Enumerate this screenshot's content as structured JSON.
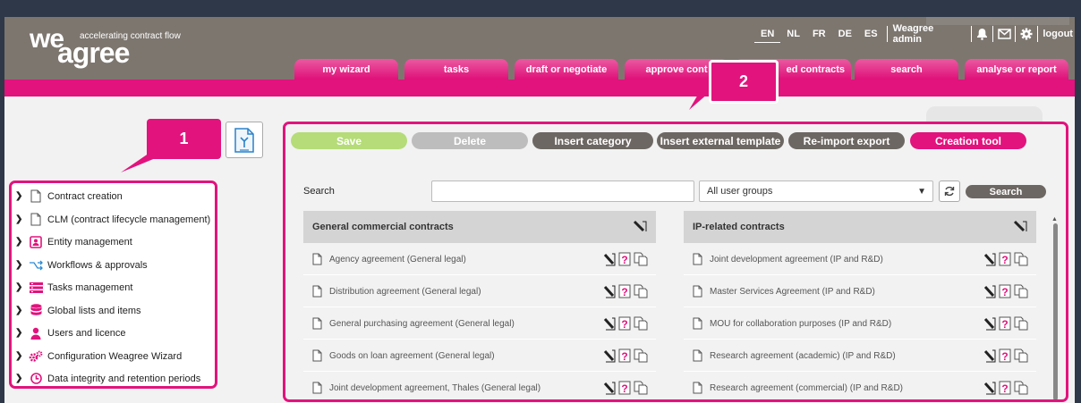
{
  "logo": {
    "line1": "we",
    "line2": "agree",
    "tagline": "accelerating contract flow"
  },
  "topnav": {
    "languages": [
      "EN",
      "NL",
      "FR",
      "DE",
      "ES"
    ],
    "active_language": "EN",
    "user": "Weagree admin",
    "logout": "logout"
  },
  "tabs": [
    "my wizard",
    "tasks",
    "draft or negotiate",
    "approve cont",
    "ed contracts",
    "search",
    "analyse or report"
  ],
  "callouts": [
    "1",
    "2"
  ],
  "sidebar": {
    "items": [
      {
        "label": "Contract creation",
        "icon": "document-icon"
      },
      {
        "label": "CLM (contract lifecycle management)",
        "icon": "document-icon"
      },
      {
        "label": "Entity management",
        "icon": "entity-card-icon"
      },
      {
        "label": "Workflows & approvals",
        "icon": "workflow-icon"
      },
      {
        "label": "Tasks management",
        "icon": "tasks-icon"
      },
      {
        "label": "Global lists and items",
        "icon": "database-icon"
      },
      {
        "label": "Users and licence",
        "icon": "user-icon"
      },
      {
        "label": "Configuration Weagree Wizard",
        "icon": "gears-icon"
      },
      {
        "label": "Data integrity and retention periods",
        "icon": "clock-icon"
      }
    ]
  },
  "toolbar": {
    "save": "Save",
    "delete": "Delete",
    "insert_category": "Insert category",
    "insert_external_template": "Insert external template",
    "reimport_export": "Re-import export",
    "creation_tool": "Creation tool"
  },
  "search": {
    "label": "Search",
    "value": "",
    "group_selected": "All user groups",
    "button": "Search"
  },
  "columns": [
    {
      "title": "General commercial contracts",
      "rows": [
        "Agency agreement (General legal)",
        "Distribution agreement (General legal)",
        "General purchasing agreement (General legal)",
        "Goods on loan agreement (General legal)",
        "Joint development agreement, Thales (General legal)"
      ]
    },
    {
      "title": "IP-related contracts",
      "rows": [
        "Joint development agreement (IP and R&D)",
        "Master Services Agreement (IP and R&D)",
        "MOU for collaboration purposes (IP and R&D)",
        "Research agreement (academic) (IP and R&D)",
        "Research agreement (commercial) (IP and R&D)"
      ]
    }
  ],
  "colors": {
    "brand_pink": "#e2137d",
    "header_grey": "#7d766f",
    "save_green": "#b5dc78",
    "delete_grey": "#bdbdbd",
    "button_grey": "#6d6763"
  }
}
